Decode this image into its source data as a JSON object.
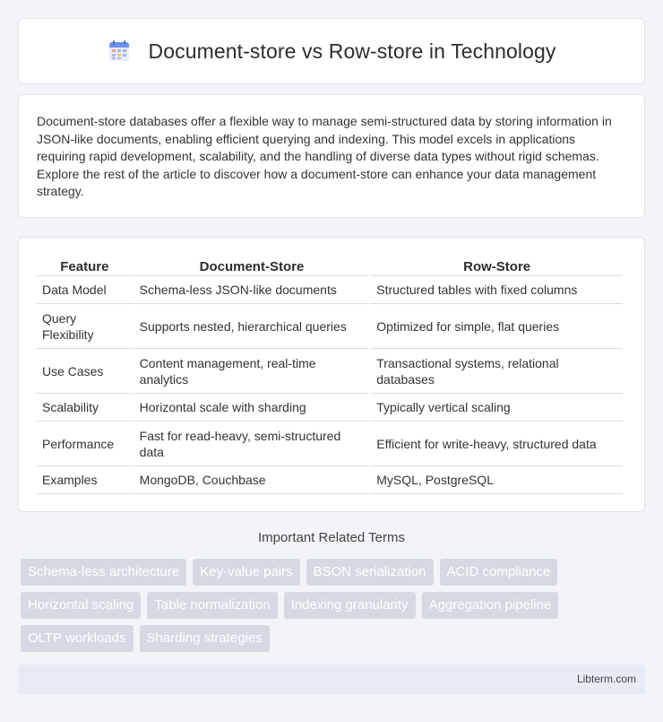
{
  "header": {
    "title": "Document-store vs Row-store in Technology",
    "icon": "table-grid-icon"
  },
  "intro": {
    "text": "Document-store databases offer a flexible way to manage semi-structured data by storing information in JSON-like documents, enabling efficient querying and indexing. This model excels in applications requiring rapid development, scalability, and the handling of diverse data types without rigid schemas. Explore the rest of the article to discover how a document-store can enhance your data management strategy."
  },
  "table": {
    "headers": [
      "Feature",
      "Document-Store",
      "Row-Store"
    ],
    "rows": [
      [
        "Data Model",
        "Schema-less JSON-like documents",
        "Structured tables with fixed columns"
      ],
      [
        "Query Flexibility",
        "Supports nested, hierarchical queries",
        "Optimized for simple, flat queries"
      ],
      [
        "Use Cases",
        "Content management, real-time analytics",
        "Transactional systems, relational databases"
      ],
      [
        "Scalability",
        "Horizontal scale with sharding",
        "Typically vertical scaling"
      ],
      [
        "Performance",
        "Fast for read-heavy, semi-structured data",
        "Efficient for write-heavy, structured data"
      ],
      [
        "Examples",
        "MongoDB, Couchbase",
        "MySQL, PostgreSQL"
      ]
    ]
  },
  "related": {
    "title": "Important Related Terms",
    "tags": [
      [
        "Schema-less architecture",
        "Key-value pairs",
        "BSON serialization",
        "ACID compliance"
      ],
      [
        "Horizontal scaling",
        "Table normalization",
        "Indexing granularity",
        "Aggregation pipeline"
      ],
      [
        "OLTP workloads",
        "Sharding strategies"
      ]
    ]
  },
  "footer": {
    "site": "Libterm.com"
  },
  "colors": {
    "background": "#f3f4f7",
    "tag_bg": "#d5d9e2",
    "footer_bg": "#e6ebf5"
  }
}
